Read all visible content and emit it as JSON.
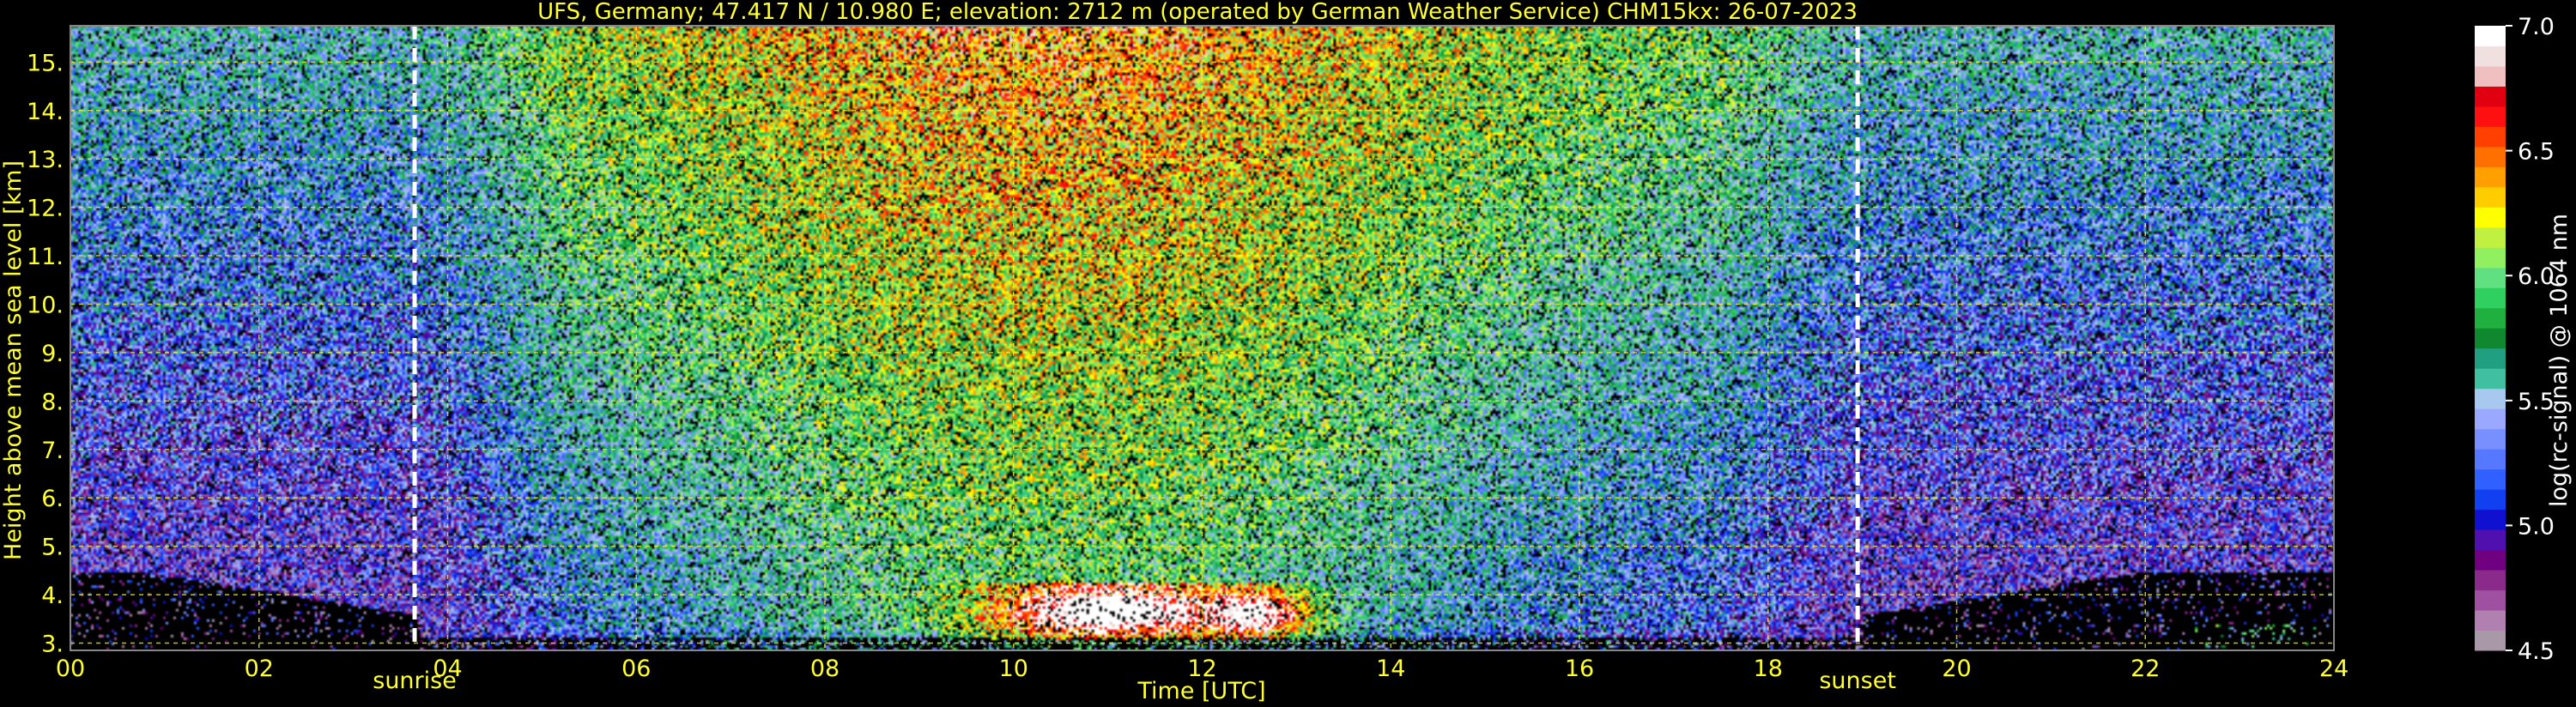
{
  "chart_data": {
    "type": "heatmap",
    "title": "UFS, Germany; 47.417 N / 10.980 E; elevation: 2712 m  (operated by German Weather Service)    CHM15kx: 26-07-2023",
    "xlabel": "Time [UTC]",
    "ylabel": "Height above mean sea level [km]",
    "x_ticks": [
      "00",
      "02",
      "04",
      "06",
      "08",
      "10",
      "12",
      "14",
      "16",
      "18",
      "20",
      "22",
      "24"
    ],
    "y_ticks": [
      "3.",
      "4.",
      "5.",
      "6.",
      "7.",
      "8.",
      "9.",
      "10.",
      "11.",
      "12.",
      "13.",
      "14.",
      "15."
    ],
    "xlim": [
      0,
      24
    ],
    "ylim": [
      2.85,
      15.75
    ],
    "grid": true,
    "annotations": [
      {
        "text": "sunrise",
        "x": 3.65
      },
      {
        "text": "sunset",
        "x": 18.95
      }
    ],
    "colorbar": {
      "label": "log(rc-signal) @ 1064 nm",
      "ticks": [
        "4.5",
        "5.0",
        "5.5",
        "6.0",
        "6.5",
        "7.0"
      ],
      "range": [
        4.5,
        7.0
      ]
    },
    "colors": {
      "axis_text": "#ffff33",
      "grid": "#ffff33",
      "marker_line": "#ffffff",
      "colorbar_text": "#ffffff"
    },
    "colormap": [
      "#a898a8",
      "#b080b0",
      "#a050a0",
      "#8a2a8a",
      "#700080",
      "#5010b0",
      "#1010d0",
      "#1040f0",
      "#3060ff",
      "#5578ff",
      "#7890ff",
      "#9aa8ff",
      "#a8c8f0",
      "#40c0a0",
      "#20a080",
      "#108830",
      "#20b040",
      "#30d060",
      "#60e080",
      "#90f060",
      "#c0f040",
      "#ffff00",
      "#ffcc00",
      "#ffa000",
      "#ff7000",
      "#ff4000",
      "#ff1010",
      "#e00010",
      "#f0c0c0",
      "#f0e0e0",
      "#ffffff"
    ],
    "signal_profile": {
      "low_night": [
        "22:00-24:00 scattered near-surface returns 3.0-3.4 km"
      ],
      "day_peak": "10:00-12:30 strong backscatter 3.2-4.3 km (values up to 7.0)"
    }
  }
}
